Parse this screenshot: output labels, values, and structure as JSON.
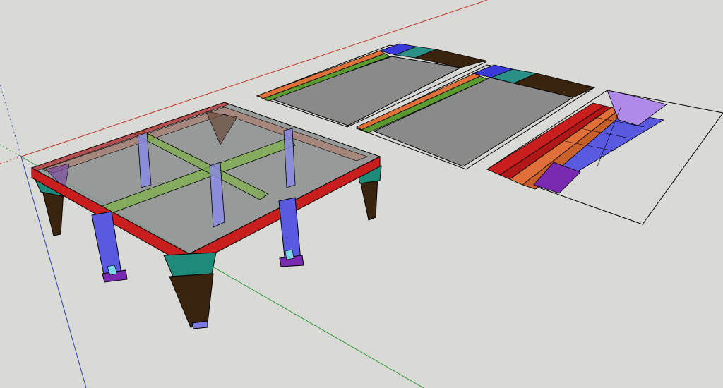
{
  "app": {
    "kind": "3d-modeling-viewport"
  },
  "scene": {
    "background": "#d9d9d5",
    "axes": {
      "red": "#c0392b",
      "green": "#2e9a3a",
      "blue": "#2f3fb0"
    },
    "objects": [
      {
        "name": "glass-top-table-model",
        "parts": [
          "glass-top",
          "red-frame",
          "green-cross-rails",
          "blue-braces",
          "dark-brown-legs",
          "teal-leg-caps"
        ]
      },
      {
        "name": "cut-sheet-layout-1",
        "parts": [
          "gray-panel",
          "orange-strip",
          "green-strip",
          "blue-block",
          "teal-blocks",
          "brown-wedge"
        ]
      },
      {
        "name": "cut-sheet-layout-2",
        "parts": [
          "gray-panel",
          "orange-strip",
          "green-strip",
          "blue-block",
          "teal-blocks",
          "brown-wedge"
        ]
      },
      {
        "name": "cut-sheet-layout-3",
        "parts": [
          "red-strips",
          "orange-strips",
          "blue-pieces",
          "purple-pieces",
          "empty-area"
        ]
      }
    ],
    "colors": {
      "glass": "#8a8f8f",
      "frame": "#c81e1e",
      "rail": "#7fb04a",
      "brace": "#5a5ae0",
      "leg": "#3a2410",
      "cap": "#1f8a7a",
      "orange": "#e0703a",
      "green": "#5a9a30",
      "blue": "#3a3adb",
      "teal": "#2a8f86",
      "brown": "#3a2410",
      "purple": "#7a2ab0",
      "lilac": "#b08ae8"
    }
  }
}
